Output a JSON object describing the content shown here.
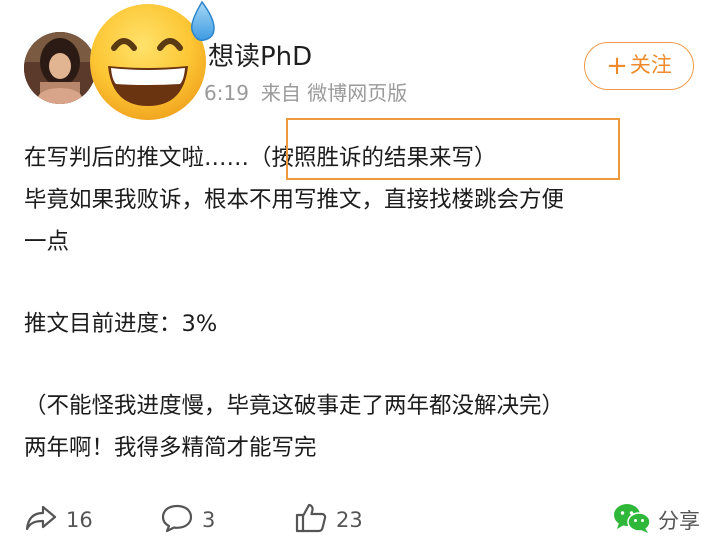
{
  "post": {
    "author": {
      "name": "想读PhD",
      "avatar_icon": "avatar-photo"
    },
    "overlay_emoji": "grinning-sweat-emoji",
    "time": "6:19",
    "source": "来自 微博网页版",
    "follow_label": "关注",
    "follow_icon": "plus-icon",
    "accent_color": "#f08a2c",
    "content_lines": [
      "在写判后的推文啦……（按照胜诉的结果来写）",
      "毕竟如果我败诉，根本不用写推文，直接找楼跳会方便",
      "一点",
      "推文目前进度：3%",
      "（不能怪我进度慢，毕竟这破事走了两年都没解决完）",
      "两年啊！我得多精简才能写完"
    ],
    "highlighted_text": "（按照胜诉的结果来写）",
    "actions": {
      "repost_count": "16",
      "comment_count": "3",
      "like_count": "23",
      "share_label": "分享"
    }
  }
}
